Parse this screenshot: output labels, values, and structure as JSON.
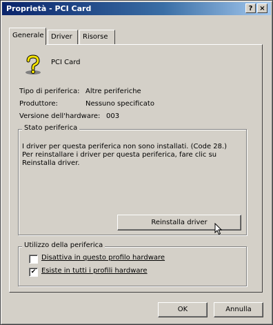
{
  "window": {
    "title": "Proprietà - PCI Card"
  },
  "titlebar_buttons": {
    "help": "?",
    "close": "×"
  },
  "tabs": [
    {
      "label": "Generale"
    },
    {
      "label": "Driver"
    },
    {
      "label": "Risorse"
    }
  ],
  "device": {
    "name": "PCI Card",
    "icon": "unknown-device-question-icon"
  },
  "properties": {
    "type_label": "Tipo di periferica:",
    "type_value": "Altre periferiche",
    "manufacturer_label": "Produttore:",
    "manufacturer_value": "Nessuno specificato",
    "hw_version_label": "Versione dell'hardware:",
    "hw_version_value": "003"
  },
  "status_group": {
    "title": "Stato periferica",
    "line1": "I driver per questa periferica non sono installati. (Code 28.)",
    "line2": "Per reinstallare i driver per questa periferica, fare clic su",
    "line3": "Reinstalla driver.",
    "reinstall_button": "Reinstalla driver"
  },
  "usage_group": {
    "title": "Utilizzo della periferica",
    "disable_label": "Disattiva in questo profilo hardware",
    "disable_checked": false,
    "exists_label": "Esiste in tutti i profili hardware",
    "exists_checked": true
  },
  "footer": {
    "ok": "OK",
    "cancel": "Annulla"
  }
}
